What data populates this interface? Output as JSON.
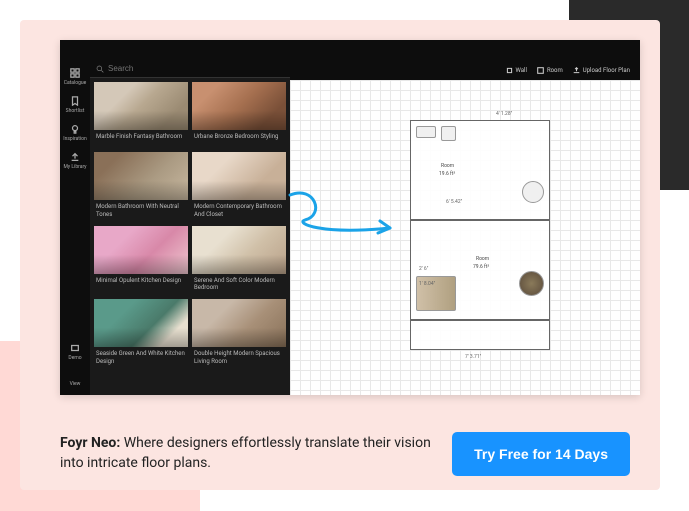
{
  "search": {
    "placeholder": "Search"
  },
  "sidebar": {
    "items": [
      {
        "label": "Catalogue"
      },
      {
        "label": "Shortlist"
      },
      {
        "label": "Inspiration"
      },
      {
        "label": "My Library"
      }
    ],
    "bottom": {
      "label": "Demo"
    },
    "view": {
      "label": "View"
    }
  },
  "toolbar": {
    "wall": "Wall",
    "room": "Room",
    "upload": "Upload Floor Plan"
  },
  "catalog": {
    "items": [
      {
        "label": "Marble Finish Fantasy Bathroom"
      },
      {
        "label": "Urbane Bronze Bedroom Styling"
      },
      {
        "label": "Modern Bathroom With Neutral Tones"
      },
      {
        "label": "Modern Contemporary Bathroom And Closet"
      },
      {
        "label": "Minimal Opulent Kitchen Design"
      },
      {
        "label": "Serene And Soft Color Modern Bedroom"
      },
      {
        "label": "Seaside Green And White Kitchen Design"
      },
      {
        "label": "Double Height Modern Spacious Living Room"
      }
    ]
  },
  "floorplan": {
    "rooms": [
      {
        "name": "Room",
        "dim": "19.6 ft²"
      },
      {
        "name": "Room",
        "dim": "79.6 ft²"
      }
    ],
    "dims": [
      "4' 1.28\"",
      "6' 5.42\"",
      "2' 6\"",
      "1' 8.04\"",
      "7' 3.71\""
    ]
  },
  "marketing": {
    "brand": "Foyr Neo:",
    "copy": " Where designers effortlessly translate their vision into intricate floor plans."
  },
  "cta": {
    "label": "Try Free for 14 Days"
  }
}
